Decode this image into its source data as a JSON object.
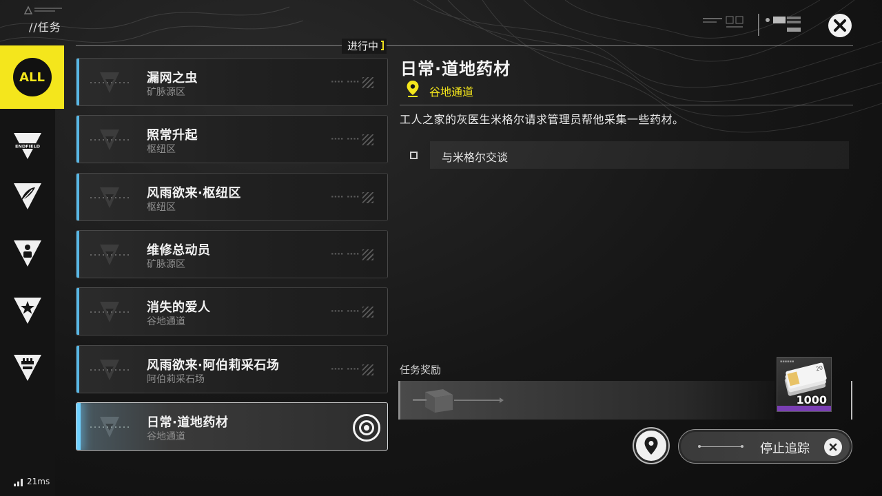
{
  "header": {
    "breadcrumb": "//任务",
    "status_tag": "进行中"
  },
  "sidebar": {
    "categories": [
      {
        "name": "all",
        "label": "ALL",
        "active": true
      },
      {
        "name": "endfield",
        "label": "ENDFIELD",
        "icon": "endfield-emblem-icon"
      },
      {
        "name": "feather",
        "icon": "feather-emblem-icon"
      },
      {
        "name": "person",
        "icon": "person-emblem-icon"
      },
      {
        "name": "star",
        "icon": "star-emblem-icon"
      },
      {
        "name": "factory",
        "icon": "factory-emblem-icon"
      }
    ]
  },
  "quests": [
    {
      "title": "漏网之虫",
      "location": "矿脉源区"
    },
    {
      "title": "照常升起",
      "location": "枢纽区"
    },
    {
      "title": "风雨欲来·枢纽区",
      "location": "枢纽区"
    },
    {
      "title": "维修总动员",
      "location": "矿脉源区"
    },
    {
      "title": "消失的爱人",
      "location": "谷地通道"
    },
    {
      "title": "风雨欲来·阿伯莉采石场",
      "location": "阿伯莉采石场"
    },
    {
      "title": "日常·道地药材",
      "location": "谷地通道",
      "selected": true,
      "tracked": true
    }
  ],
  "detail": {
    "title": "日常·道地药材",
    "location": "谷地通道",
    "description": "工人之家的灰医生米格尔请求管理员帮他采集一些药材。",
    "objectives": [
      {
        "text": "与米格尔交谈",
        "done": false
      }
    ],
    "rewards_label": "任务奖励",
    "rewards": [
      {
        "icon": "cash-bundle-icon",
        "quantity": "1000",
        "rarity_color": "#7a3fb4"
      }
    ]
  },
  "actions": {
    "stop_tracking": "停止追踪"
  },
  "status": {
    "ping": "21ms"
  },
  "colors": {
    "accent_yellow": "#f4e61c",
    "accent_blue": "#58b8e6"
  }
}
